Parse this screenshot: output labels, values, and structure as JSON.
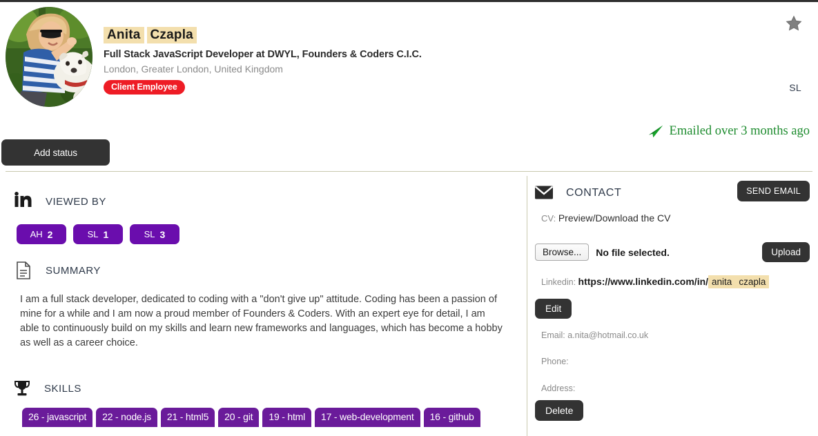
{
  "header": {
    "name_parts": [
      "Anita",
      "Czapla"
    ],
    "headline": "Full Stack JavaScript Developer at DWYL, Founders & Coders C.I.C.",
    "location": "London, Greater London, United Kingdom",
    "role_badge": "Client Employee",
    "star_icon": "star-icon",
    "owner_initials": "SL",
    "emailed_status": "Emailed over 3 months ago",
    "emailed_icon": "paper-plane-icon",
    "add_status_label": "Add status",
    "avatar_alt": "profile-photo"
  },
  "left": {
    "viewed_by": {
      "icon": "linkedin-icon",
      "title": "VIEWED BY",
      "badges": [
        {
          "initials": "AH",
          "count": "2"
        },
        {
          "initials": "SL",
          "count": "1"
        },
        {
          "initials": "SL",
          "count": "3"
        }
      ]
    },
    "summary": {
      "icon": "document-icon",
      "title": "SUMMARY",
      "text": "I am a full stack developer, dedicated to coding with a \"don't give up\" attitude. Coding has been a passion of mine for a while and I am now a proud member of Founders & Coders. With an expert eye for detail, I am able to continuously build on my skills and learn new frameworks and languages, which has become a hobby as well as a career choice."
    },
    "skills": {
      "icon": "trophy-icon",
      "title": "SKILLS",
      "tags": [
        "26 - javascript",
        "22 - node.js",
        "21 - html5",
        "20 - git",
        "19 - html",
        "17 - web-development",
        "16 - github"
      ]
    }
  },
  "right": {
    "contact": {
      "icon": "envelope-icon",
      "title": "CONTACT",
      "send_email_label": "SEND EMAIL",
      "cv_label": "CV:",
      "cv_link": "Preview/Download the CV",
      "browse_label": "Browse...",
      "no_file_label": "No file selected.",
      "upload_label": "Upload",
      "linkedin_label": "Linkedin:",
      "linkedin_url": "https://www.linkedin.com/in/",
      "linkedin_slug_parts": [
        "anita",
        "czapla"
      ],
      "edit_label": "Edit",
      "email_line": "Email: a.nita@hotmail.co.uk",
      "phone_line": "Phone:",
      "address_line": "Address:",
      "delete_label": "Delete"
    }
  },
  "colors": {
    "highlight": "#f3dfad",
    "badge_red": "#ee1c25",
    "purple": "#6a0dad",
    "skill_purple": "#6a1b9a",
    "dark_button": "#333333",
    "green_text": "#1e8c2f",
    "star_gray": "#808080",
    "divider": "#c8c8ae"
  }
}
